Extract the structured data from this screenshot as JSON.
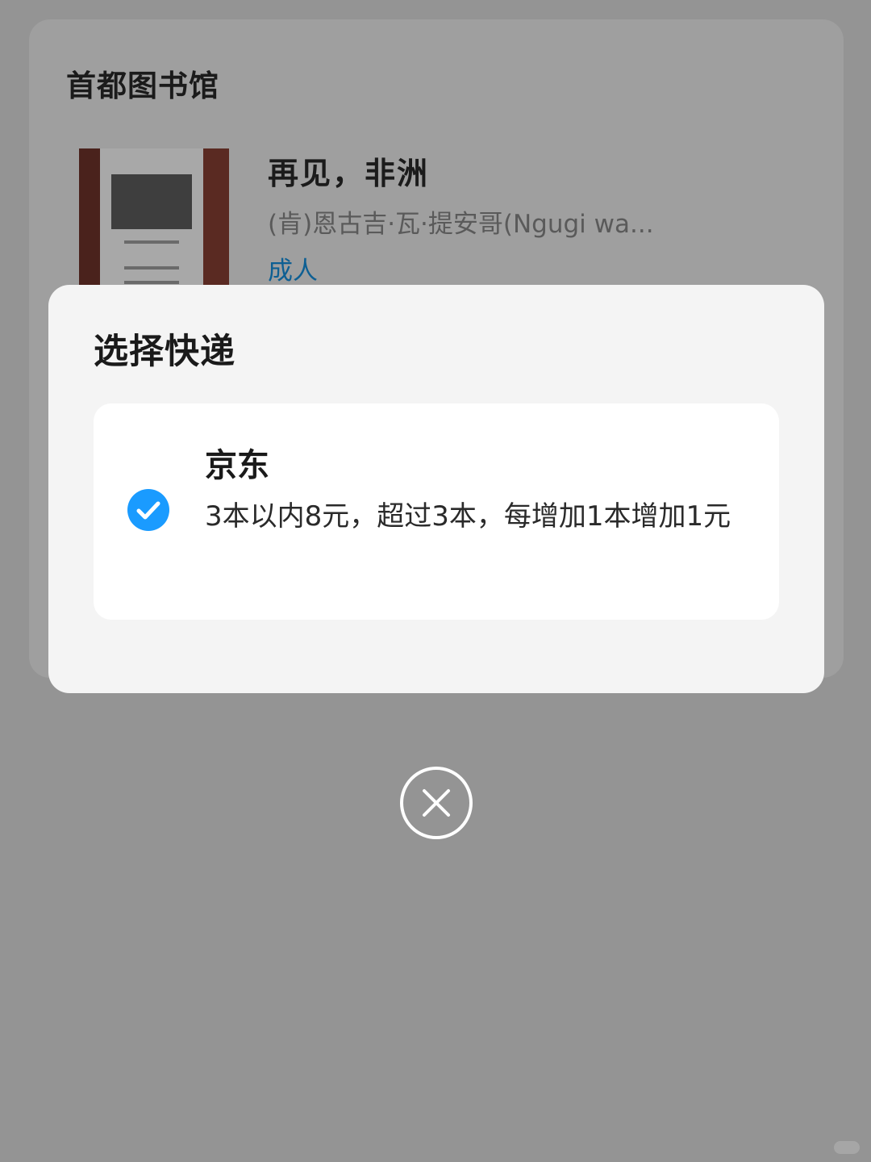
{
  "library": {
    "name": "首都图书馆"
  },
  "book": {
    "title": "再见，非洲",
    "author": "(肯)恩古吉·瓦·提安哥(Ngugi wa...",
    "tag": "成人",
    "tag_color": "#0d5f93"
  },
  "modal": {
    "title": "选择快递",
    "option": {
      "name": "京东",
      "description": "3本以内8元，超过3本，每增加1本增加1元",
      "selected": true,
      "check_icon": "check-circle-icon",
      "check_color": "#1a9bff"
    }
  },
  "close_icon": "close-circle-icon",
  "colors": {
    "overlay": "#949494",
    "modal_bg": "#f4f4f4",
    "card_bg": "#ffffff"
  }
}
